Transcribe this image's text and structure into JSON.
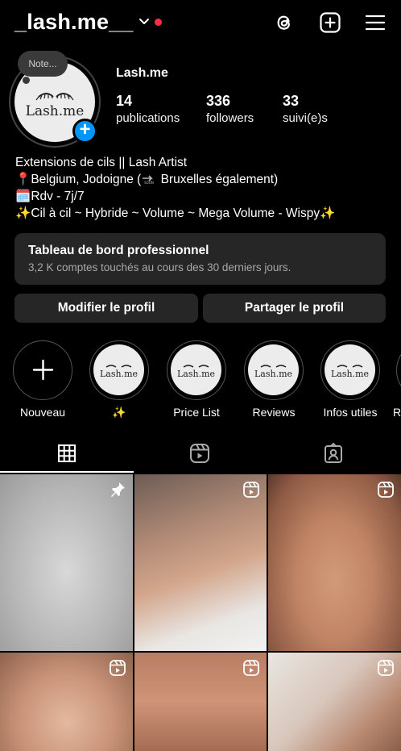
{
  "header": {
    "username": "_lash.me__",
    "icons": [
      "threads-icon",
      "create-plus-icon",
      "menu-icon"
    ]
  },
  "profile": {
    "note": "Note...",
    "avatar_text": "Lash.me",
    "display_name": "Lash.me",
    "stats": [
      {
        "num": "14",
        "label": "publications"
      },
      {
        "num": "336",
        "label": "followers"
      },
      {
        "num": "33",
        "label": "suivi(e)s"
      }
    ]
  },
  "bio": {
    "line1": "Extensions de cils || Lash Artist",
    "line2_a": "Belgium, Jodoigne (",
    "line2_b": " Bruxelles également)",
    "line3": "Rdv - 7j/7",
    "line4": "Cil à cil ~ Hybride ~ Volume ~ Mega Volume - Wispy"
  },
  "dashboard": {
    "title": "Tableau de bord professionnel",
    "subtitle": "3,2 K comptes touchés au cours des 30 derniers jours."
  },
  "buttons": {
    "edit": "Modifier le profil",
    "share": "Partager le profil"
  },
  "highlights": [
    {
      "label": "Nouveau"
    },
    {
      "label": "✨"
    },
    {
      "label": "Price List"
    },
    {
      "label": "Reviews"
    },
    {
      "label": "Infos utiles"
    },
    {
      "label": "R"
    }
  ],
  "highlight_logo": "Lash.me",
  "tabs": [
    "grid-icon",
    "reels-icon",
    "tagged-icon"
  ],
  "colors": {
    "background": "#000000",
    "surface": "#262626",
    "accent": "#0095f6",
    "notification": "#ff2e45"
  }
}
